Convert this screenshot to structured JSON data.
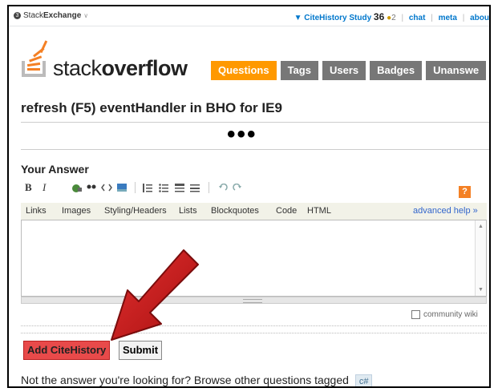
{
  "topbar": {
    "network_prefix": "Stack",
    "network_bold": "Exchange",
    "network_chevron": "∨",
    "site_name": "▼ CiteHistory Study",
    "reputation": "36",
    "badge_dot": "●",
    "badge_count": "2",
    "links": [
      "chat",
      "meta",
      "abou"
    ]
  },
  "header": {
    "logo_light": "stack",
    "logo_bold": "overflow",
    "nav": [
      "Questions",
      "Tags",
      "Users",
      "Badges",
      "Unanswe"
    ]
  },
  "question": {
    "title": "refresh (F5) eventHandler in BHO for IE9",
    "ellipsis": "•••"
  },
  "answer": {
    "heading": "Your Answer",
    "toolbar": {
      "bold": "B",
      "italic": "I",
      "help": "?"
    },
    "links_bar": {
      "items": [
        "Links",
        "Images",
        "Styling/Headers",
        "Lists",
        "Blockquotes",
        "Code",
        "HTML"
      ],
      "advanced": "advanced help »"
    },
    "textarea_value": "",
    "community_wiki": "community wiki"
  },
  "buttons": {
    "cite": "Add CiteHistory",
    "submit": "Submit"
  },
  "footer": {
    "text": "Not the answer you're looking for? Browse other questions tagged",
    "tag": "c#"
  },
  "colors": {
    "accent_orange": "#ff9900",
    "nav_gray": "#777777",
    "cite_red": "#e84a4a",
    "arrow_red": "#c81e1e",
    "link_blue": "#0077cc"
  }
}
